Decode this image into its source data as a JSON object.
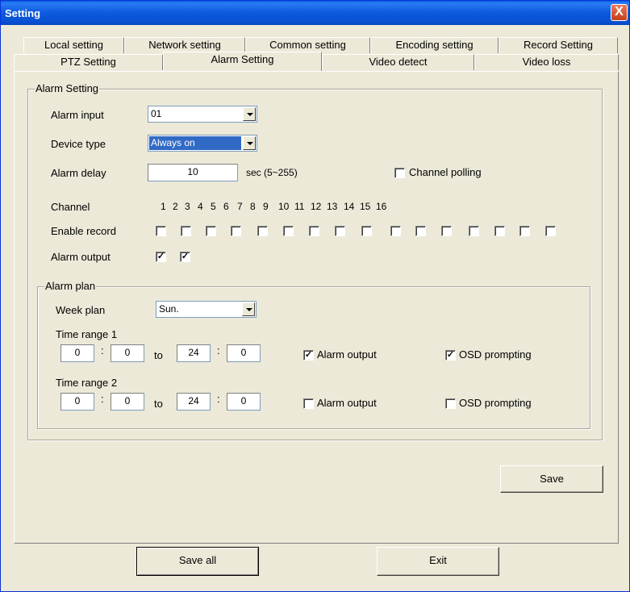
{
  "window": {
    "title": "Setting",
    "close_glyph": "X"
  },
  "tabs": {
    "row1": [
      "Local setting",
      "Network setting",
      "Common setting",
      "Encoding setting",
      "Record Setting"
    ],
    "row2": [
      "PTZ Setting",
      "Alarm Setting",
      "Video detect",
      "Video loss"
    ],
    "active": "Alarm Setting"
  },
  "alarm_setting": {
    "legend": "Alarm Setting",
    "alarm_input_label": "Alarm input",
    "alarm_input_value": "01",
    "device_type_label": "Device type",
    "device_type_value": "Always on",
    "alarm_delay_label": "Alarm delay",
    "alarm_delay_value": "10",
    "alarm_delay_unit": "sec (5~255)",
    "channel_polling_label": "Channel polling",
    "channel_polling_checked": false,
    "channel_label": "Channel",
    "channels": [
      "1",
      "2",
      "3",
      "4",
      "5",
      "6",
      "7",
      "8",
      "9",
      "10",
      "11",
      "12",
      "13",
      "14",
      "15",
      "16"
    ],
    "enable_record_label": "Enable record",
    "enable_record": [
      false,
      false,
      false,
      false,
      false,
      false,
      false,
      false,
      false,
      false,
      false,
      false,
      false,
      false,
      false,
      false
    ],
    "alarm_output_label": "Alarm output",
    "alarm_output": [
      true,
      true
    ]
  },
  "alarm_plan": {
    "legend": "Alarm plan",
    "week_plan_label": "Week plan",
    "week_plan_value": "Sun.",
    "colon": ":",
    "to_label": "to",
    "ranges": [
      {
        "label": "Time range 1",
        "start_h": "0",
        "start_m": "0",
        "end_h": "24",
        "end_m": "0",
        "alarm_output_label": "Alarm output",
        "alarm_output": true,
        "osd_label": "OSD prompting",
        "osd": true
      },
      {
        "label": "Time range 2",
        "start_h": "0",
        "start_m": "0",
        "end_h": "24",
        "end_m": "0",
        "alarm_output_label": "Alarm output",
        "alarm_output": false,
        "osd_label": "OSD prompting",
        "osd": false
      }
    ]
  },
  "buttons": {
    "save": "Save",
    "save_all": "Save all",
    "exit": "Exit"
  },
  "check_glyph": "✓"
}
